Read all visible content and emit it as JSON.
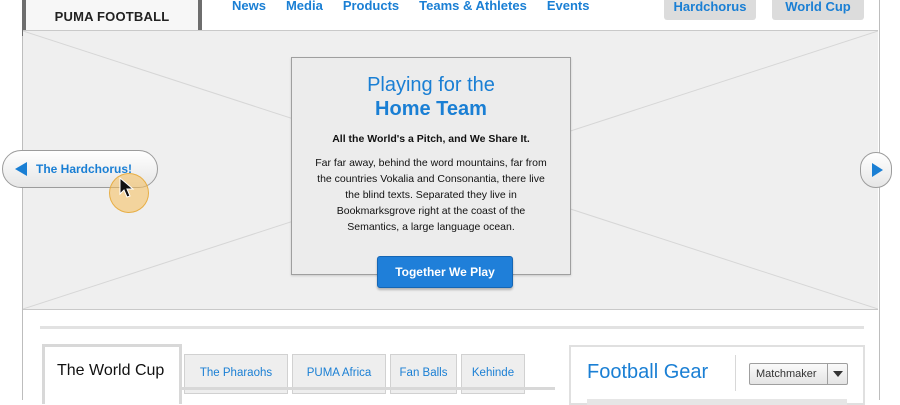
{
  "header": {
    "logo": "PUMA FOOTBALL",
    "nav": [
      "News",
      "Media",
      "Products",
      "Teams & Athletes",
      "Events"
    ],
    "pills": [
      "Hardchorus",
      "World Cup"
    ]
  },
  "hero": {
    "title_line1": "Playing for the",
    "title_line2": "Home Team",
    "subtitle": "All the World's a Pitch, and We Share It.",
    "body": "Far far away, behind the word mountains, far from the countries Vokalia and Consonantia, there live the blind texts. Separated they live in Bookmarksgrove right at the coast of the Semantics, a large language ocean.",
    "cta": "Together We Play",
    "prev_label": "The Hardchorus!"
  },
  "tabs": {
    "active": "The World Cup",
    "items": [
      "The Pharaohs",
      "PUMA Africa",
      "Fan Balls",
      "Kehinde"
    ]
  },
  "gear": {
    "title": "Football Gear",
    "dropdown_value": "Matchmaker"
  },
  "colors": {
    "accent": "#1a7fd4",
    "cta": "#1f7fd9",
    "halo": "#f5be5a"
  },
  "icons": {
    "prev": "triangle-left-icon",
    "next": "triangle-right-icon",
    "cursor": "mouse-pointer-icon",
    "dropdown": "chevron-down-icon"
  }
}
